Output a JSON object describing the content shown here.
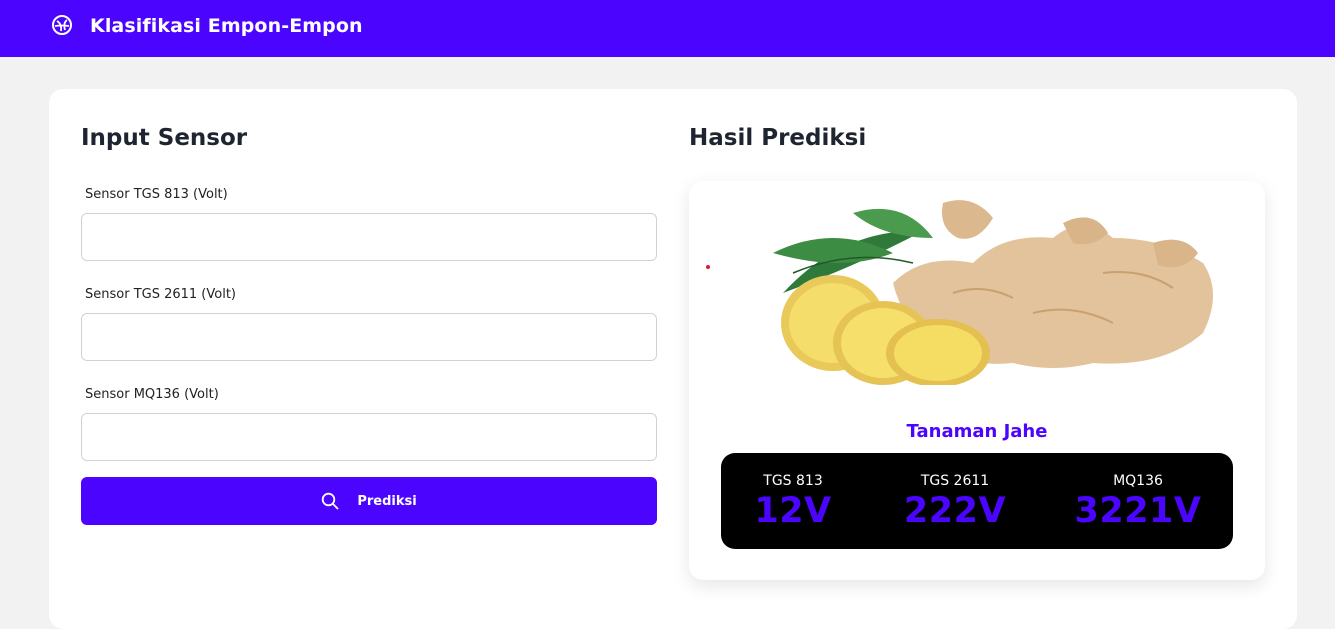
{
  "app": {
    "title": "Klasifikasi Empon-Empon",
    "brand_color": "#4b05ff",
    "icon": "leaf-circle-icon"
  },
  "input_section": {
    "title": "Input Sensor",
    "fields": [
      {
        "label": "Sensor TGS 813 (Volt)",
        "value": "",
        "placeholder": ""
      },
      {
        "label": "Sensor TGS 2611 (Volt)",
        "value": "",
        "placeholder": ""
      },
      {
        "label": "Sensor MQ136 (Volt)",
        "value": "",
        "placeholder": ""
      }
    ],
    "button": {
      "label": "Prediksi",
      "icon": "search-icon"
    }
  },
  "result_section": {
    "title": "Hasil Prediksi",
    "image": "ginger-image",
    "prediction": "Tanaman Jahe",
    "readings": [
      {
        "label": "TGS 813",
        "value": "12V"
      },
      {
        "label": "TGS 2611",
        "value": "222V"
      },
      {
        "label": "MQ136",
        "value": "3221V"
      }
    ]
  }
}
